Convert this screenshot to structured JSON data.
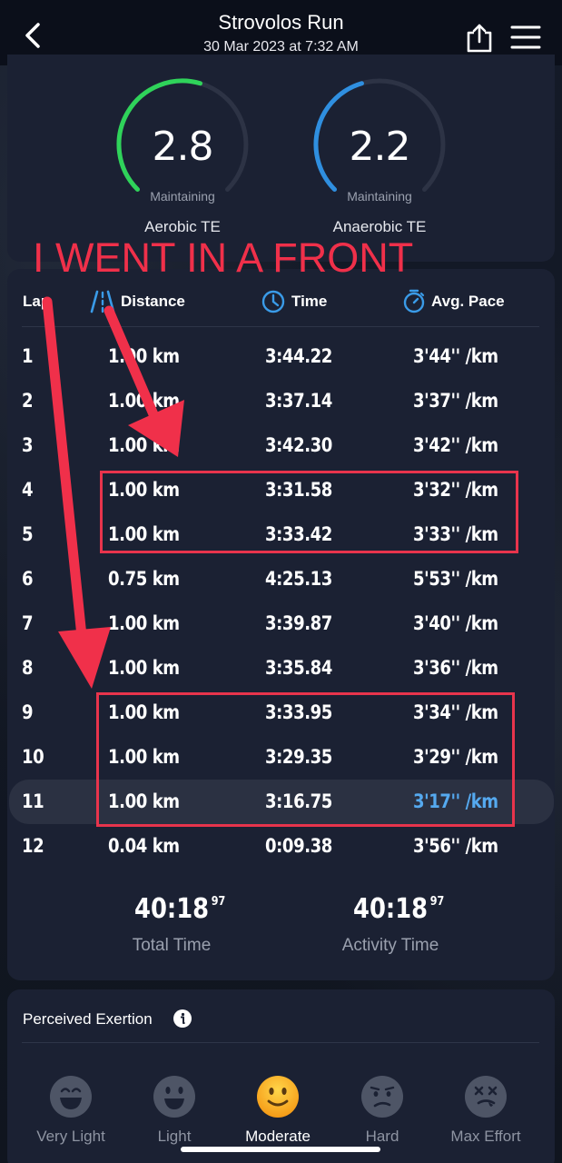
{
  "header": {
    "title": "Strovolos Run",
    "subtitle": "30 Mar 2023 at 7:32 AM"
  },
  "training_effect": {
    "aerobic": {
      "value": "2.8",
      "status": "Maintaining",
      "label": "Aerobic TE",
      "color": "#2fd35a",
      "level": 0.56
    },
    "anaerobic": {
      "value": "2.2",
      "status": "Maintaining",
      "label": "Anaerobic TE",
      "color": "#2f8fe0",
      "level": 0.44
    }
  },
  "laps": {
    "headers": {
      "lap": "Lap",
      "distance": "Distance",
      "time": "Time",
      "pace": "Avg. Pace"
    },
    "rows": [
      {
        "lap": "1",
        "distance": "1.00 km",
        "time": "3:44.22",
        "pace": "3'44'' /km"
      },
      {
        "lap": "2",
        "distance": "1.00 km",
        "time": "3:37.14",
        "pace": "3'37'' /km"
      },
      {
        "lap": "3",
        "distance": "1.00 km",
        "time": "3:42.30",
        "pace": "3'42'' /km"
      },
      {
        "lap": "4",
        "distance": "1.00 km",
        "time": "3:31.58",
        "pace": "3'32'' /km"
      },
      {
        "lap": "5",
        "distance": "1.00 km",
        "time": "3:33.42",
        "pace": "3'33'' /km"
      },
      {
        "lap": "6",
        "distance": "0.75 km",
        "time": "4:25.13",
        "pace": "5'53'' /km"
      },
      {
        "lap": "7",
        "distance": "1.00 km",
        "time": "3:39.87",
        "pace": "3'40'' /km"
      },
      {
        "lap": "8",
        "distance": "1.00 km",
        "time": "3:35.84",
        "pace": "3'36'' /km"
      },
      {
        "lap": "9",
        "distance": "1.00 km",
        "time": "3:33.95",
        "pace": "3'34'' /km"
      },
      {
        "lap": "10",
        "distance": "1.00 km",
        "time": "3:29.35",
        "pace": "3'29'' /km"
      },
      {
        "lap": "11",
        "distance": "1.00 km",
        "time": "3:16.75",
        "pace": "3'17'' /km"
      },
      {
        "lap": "12",
        "distance": "0.04 km",
        "time": "0:09.38",
        "pace": "3'56'' /km"
      }
    ],
    "highlighted_lap": "11",
    "accent_color": "#55a9ef"
  },
  "summary": {
    "total_time": {
      "main": "40:18",
      "sub": "97",
      "label": "Total Time"
    },
    "activity_time": {
      "main": "40:18",
      "sub": "97",
      "label": "Activity Time"
    }
  },
  "exertion": {
    "title": "Perceived Exertion",
    "options": [
      {
        "label": "Very Light",
        "icon": "grinning-face-icon"
      },
      {
        "label": "Light",
        "icon": "smiling-face-icon"
      },
      {
        "label": "Moderate",
        "icon": "slightly-smiling-face-icon",
        "selected": true
      },
      {
        "label": "Hard",
        "icon": "confused-face-icon"
      },
      {
        "label": "Max Effort",
        "icon": "dizzy-face-icon"
      }
    ],
    "selected_color": "#f6a81c"
  },
  "annotation": {
    "text": "I WENT IN A FRONT",
    "color": "#f0304a"
  }
}
